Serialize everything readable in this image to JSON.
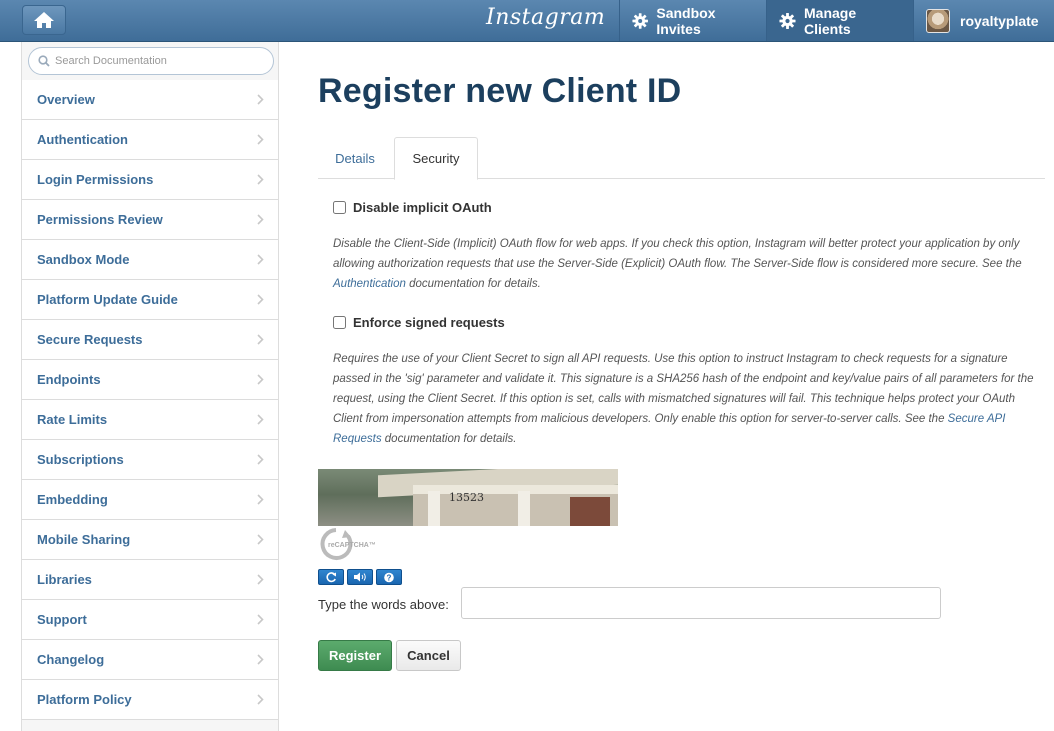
{
  "topbar": {
    "logo": "Instagram",
    "nav": [
      {
        "label": "Sandbox Invites",
        "icon": "gear-icon"
      },
      {
        "label": "Manage Clients",
        "icon": "gear-icon"
      },
      {
        "label": "royaltyplate",
        "icon": "avatar"
      }
    ]
  },
  "sidebar": {
    "search_placeholder": "Search Documentation",
    "items": [
      {
        "label": "Overview"
      },
      {
        "label": "Authentication"
      },
      {
        "label": "Login Permissions"
      },
      {
        "label": "Permissions Review"
      },
      {
        "label": "Sandbox Mode"
      },
      {
        "label": "Platform Update Guide"
      },
      {
        "label": "Secure Requests"
      },
      {
        "label": "Endpoints"
      },
      {
        "label": "Rate Limits"
      },
      {
        "label": "Subscriptions"
      },
      {
        "label": "Embedding"
      },
      {
        "label": "Mobile Sharing"
      },
      {
        "label": "Libraries"
      },
      {
        "label": "Support"
      },
      {
        "label": "Changelog"
      },
      {
        "label": "Platform Policy"
      }
    ]
  },
  "main": {
    "title": "Register new Client ID",
    "tabs": [
      {
        "label": "Details",
        "active": false
      },
      {
        "label": "Security",
        "active": true
      }
    ],
    "options": [
      {
        "label": "Disable implicit OAuth",
        "checked": false,
        "desc_before": "Disable the Client-Side (Implicit) OAuth flow for web apps. If you check this option, Instagram will better protect your application by only allowing authorization requests that use the Server-Side (Explicit) OAuth flow. The Server-Side flow is considered more secure. See the ",
        "link": "Authentication",
        "desc_after": " documentation for details."
      },
      {
        "label": "Enforce signed requests",
        "checked": false,
        "desc_before": "Requires the use of your Client Secret to sign all API requests. Use this option to instruct Instagram to check requests for a signature passed in the 'sig' parameter and validate it. This signature is a SHA256 hash of the endpoint and key/value pairs of all parameters for the request, using the Client Secret. If this option is set, calls with mismatched signatures will fail. This technique helps protect your OAuth Client from impersonation attempts from malicious developers. Only enable this option for server-to-server calls. See the ",
        "link": "Secure API Requests",
        "desc_after": " documentation for details."
      }
    ],
    "captcha": {
      "image_text": "13523",
      "logo_text": "reCAPTCHA™",
      "label": "Type the words above:",
      "value": ""
    },
    "buttons": {
      "register": "Register",
      "cancel": "Cancel"
    }
  },
  "colors": {
    "topbar": "#4a78a3",
    "link": "#3d6d99",
    "title": "#1c3f5e",
    "register_button": "#4a9a5d"
  }
}
